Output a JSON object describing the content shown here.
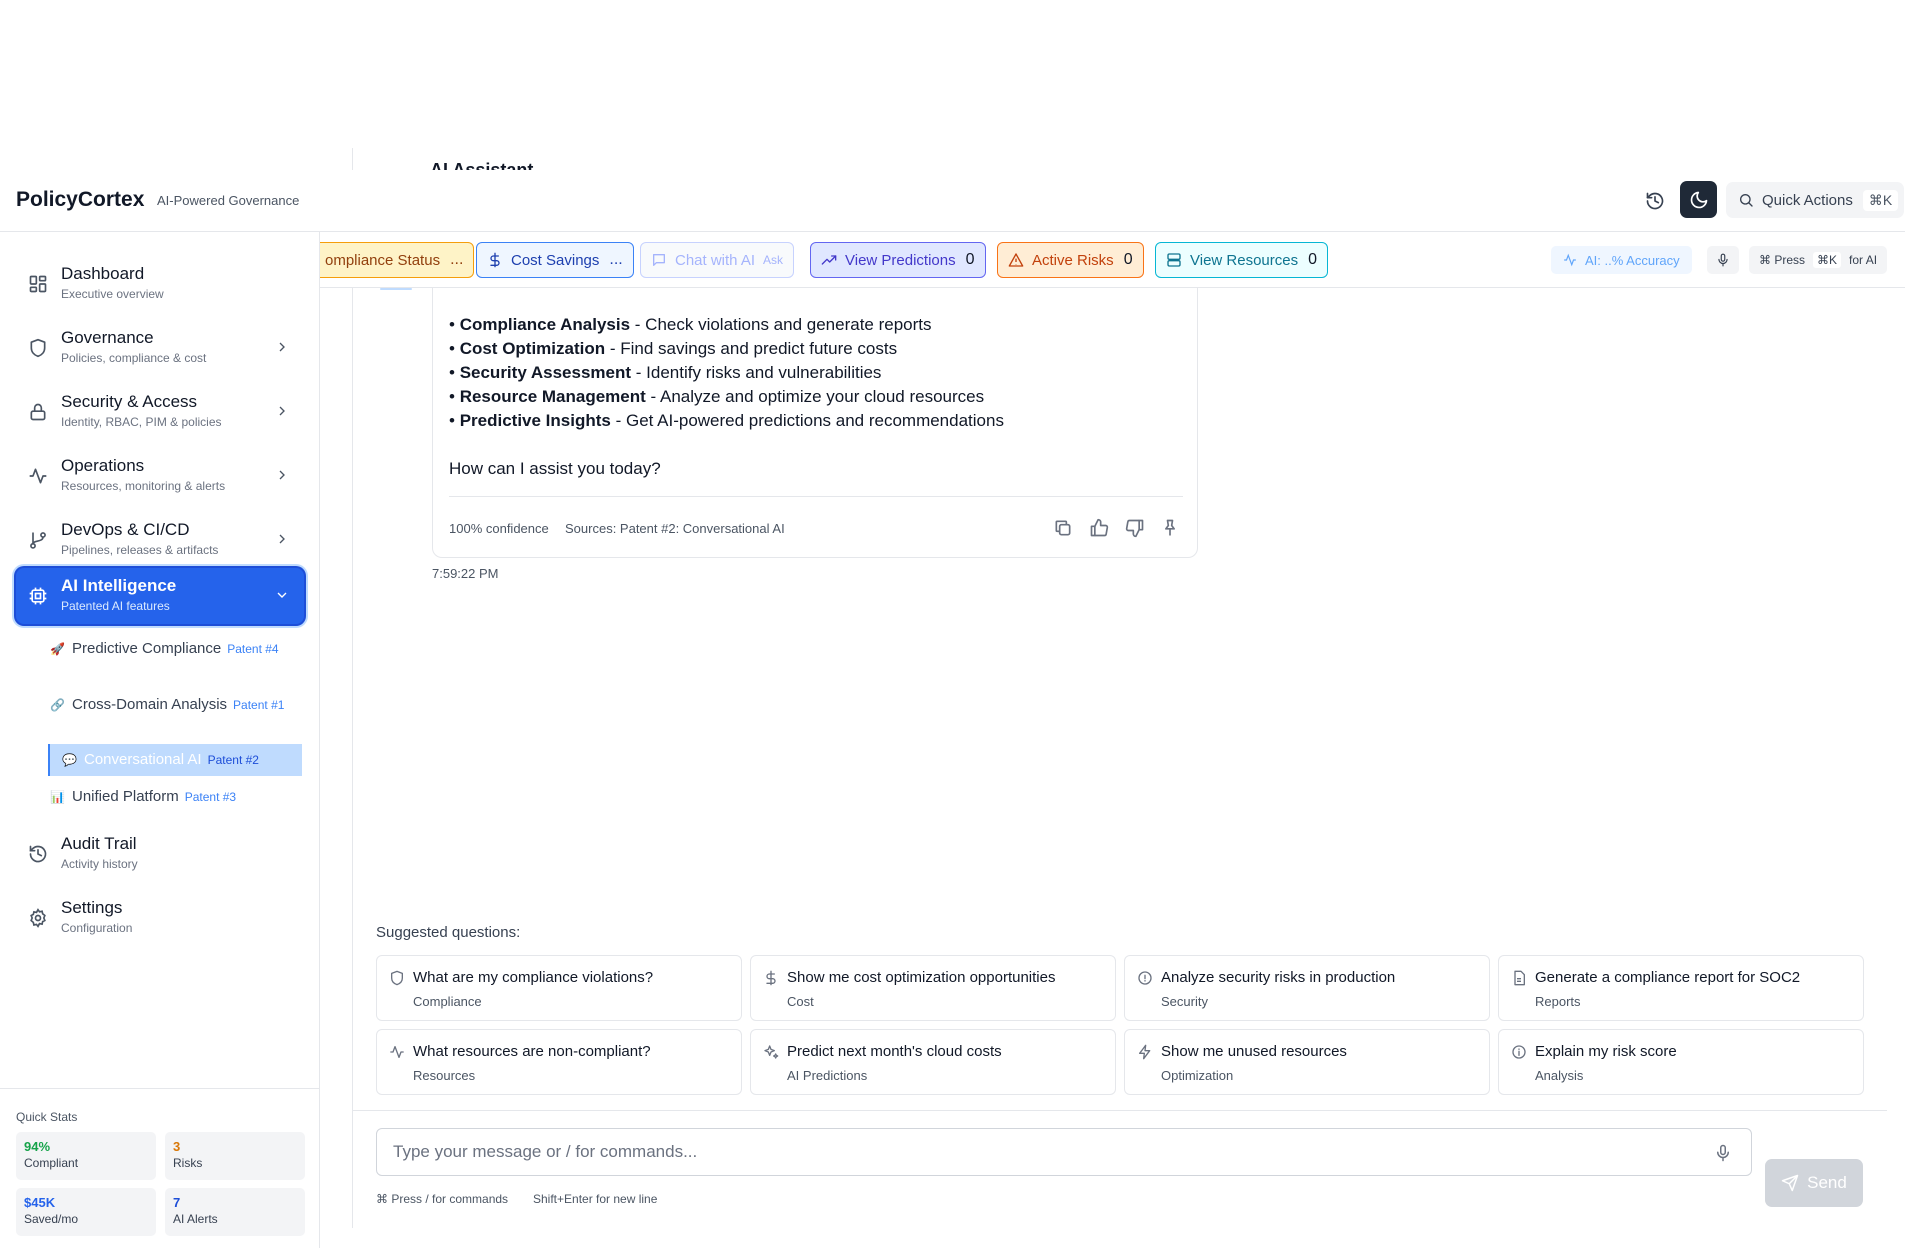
{
  "top_fragment": "AI Assistant",
  "header": {
    "brand": "PolicyCortex",
    "tagline": "AI-Powered Governance",
    "quick_actions": "Quick Actions",
    "quick_shortcut": "⌘K"
  },
  "sidebar": {
    "items": [
      {
        "label": "Dashboard",
        "sub": "Executive overview",
        "icon": "grid-icon"
      },
      {
        "label": "Governance",
        "sub": "Policies, compliance & cost",
        "icon": "shield-icon"
      },
      {
        "label": "Security & Access",
        "sub": "Identity, RBAC, PIM & policies",
        "icon": "lock-icon"
      },
      {
        "label": "Operations",
        "sub": "Resources, monitoring & alerts",
        "icon": "activity-icon"
      },
      {
        "label": "DevOps & CI/CD",
        "sub": "Pipelines, releases & artifacts",
        "icon": "git-branch-icon"
      },
      {
        "label": "AI Intelligence",
        "sub": "Patented AI features",
        "icon": "cpu-icon"
      },
      {
        "label": "Audit Trail",
        "sub": "Activity history",
        "icon": "history-icon"
      },
      {
        "label": "Settings",
        "sub": "Configuration",
        "icon": "gear-icon"
      }
    ],
    "subitems": [
      {
        "emoji": "🚀",
        "label": "Predictive Compliance",
        "patent": "Patent #4"
      },
      {
        "emoji": "🔗",
        "label": "Cross-Domain Analysis",
        "patent": "Patent #1"
      },
      {
        "emoji": "💬",
        "label": "Conversational AI",
        "patent": "Patent #2"
      },
      {
        "emoji": "📊",
        "label": "Unified Platform",
        "patent": "Patent #3"
      }
    ],
    "quick_stats": {
      "title": "Quick Stats",
      "cards": [
        {
          "value": "94%",
          "label": "Compliant",
          "color": "#16a34a"
        },
        {
          "value": "3",
          "label": "Risks",
          "color": "#d97706"
        },
        {
          "value": "$45K",
          "label": "Saved/mo",
          "color": "#2563eb"
        },
        {
          "value": "7",
          "label": "AI Alerts",
          "color": "#1d4ed8"
        }
      ]
    }
  },
  "actionbar": {
    "compliance": "ompliance Status",
    "compliance_count": "...",
    "cost": "Cost Savings",
    "cost_count": "...",
    "chat": "Chat with AI",
    "chat_ask": "Ask",
    "predictions": "View Predictions",
    "predictions_count": "0",
    "risks": "Active Risks",
    "risks_count": "0",
    "resources": "View Resources",
    "resources_count": "0",
    "ai_accuracy": "AI: ..% Accuracy",
    "press_prefix": "⌘ Press",
    "press_key": "⌘K",
    "press_suffix": "for AI"
  },
  "message": {
    "bullets": [
      {
        "bold": "Compliance Analysis",
        "text": " - Check violations and generate reports"
      },
      {
        "bold": "Cost Optimization",
        "text": " - Find savings and predict future costs"
      },
      {
        "bold": "Security Assessment",
        "text": " - Identify risks and vulnerabilities"
      },
      {
        "bold": "Resource Management",
        "text": " - Analyze and optimize your cloud resources"
      },
      {
        "bold": "Predictive Insights",
        "text": " - Get AI-powered predictions and recommendations"
      }
    ],
    "closing": "How can I assist you today?",
    "confidence": "100% confidence",
    "sources": "Sources: Patent #2: Conversational AI",
    "time": "7:59:22 PM"
  },
  "suggestions": {
    "title": "Suggested questions:",
    "items": [
      {
        "q": "What are my compliance violations?",
        "c": "Compliance",
        "icon": "shield-icon"
      },
      {
        "q": "Show me cost optimization opportunities",
        "c": "Cost",
        "icon": "dollar-icon"
      },
      {
        "q": "Analyze security risks in production",
        "c": "Security",
        "icon": "alert-circle-icon"
      },
      {
        "q": "Generate a compliance report for SOC2",
        "c": "Reports",
        "icon": "file-icon"
      },
      {
        "q": "What resources are non-compliant?",
        "c": "Resources",
        "icon": "activity-icon"
      },
      {
        "q": "Predict next month's cloud costs",
        "c": "AI Predictions",
        "icon": "sparkles-icon"
      },
      {
        "q": "Show me unused resources",
        "c": "Optimization",
        "icon": "zap-icon"
      },
      {
        "q": "Explain my risk score",
        "c": "Analysis",
        "icon": "info-icon"
      }
    ]
  },
  "input": {
    "placeholder": "Type your message or / for commands...",
    "send": "Send",
    "hint1": "⌘ Press / for commands",
    "hint2": "Shift+Enter for new line"
  }
}
